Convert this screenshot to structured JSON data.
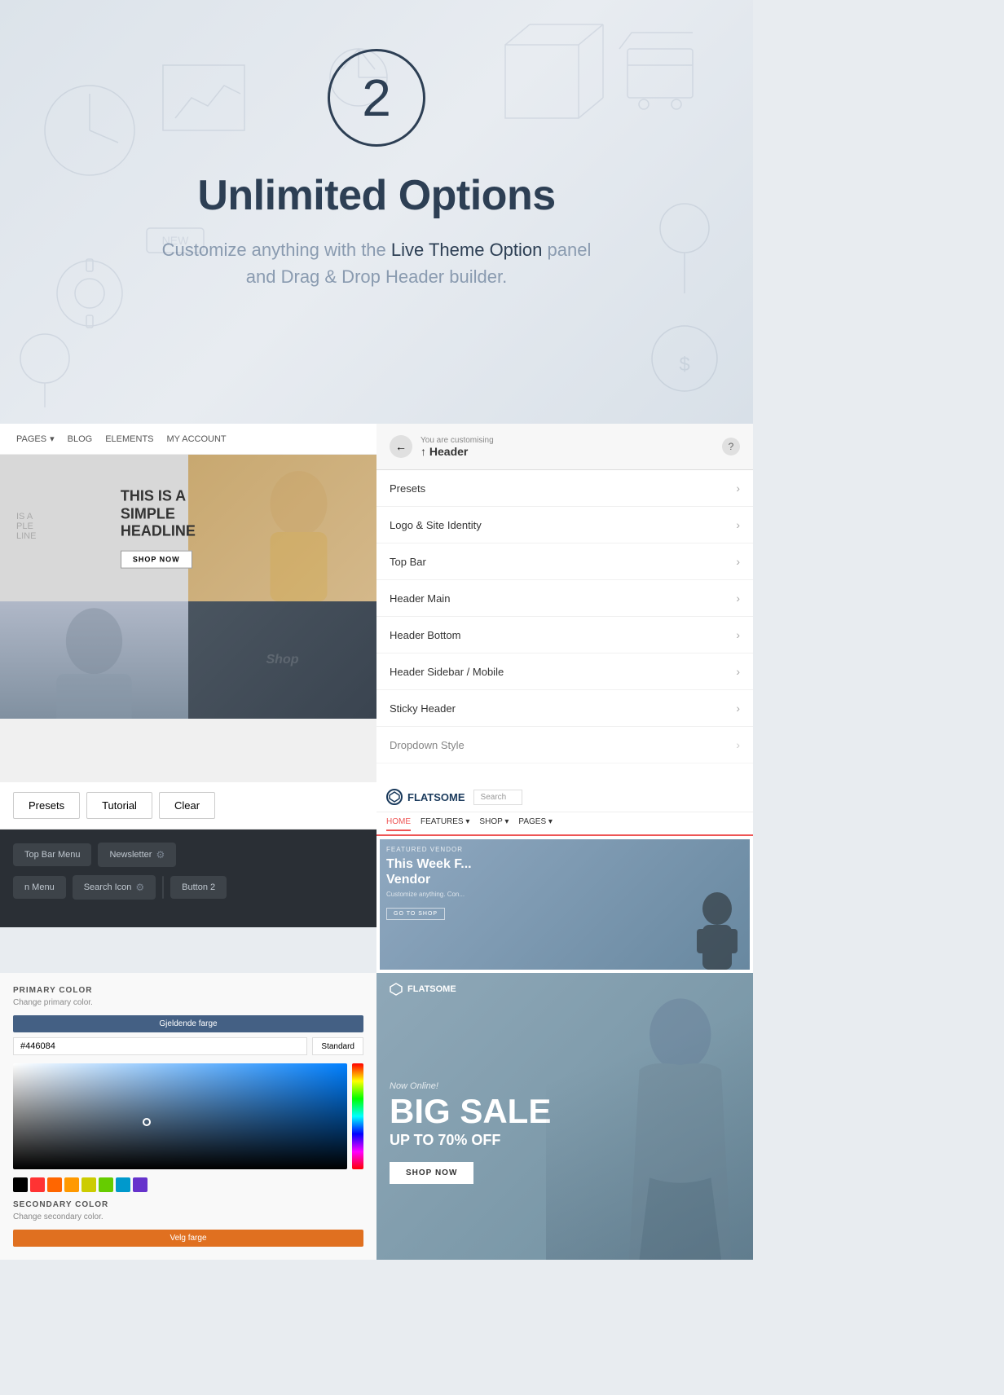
{
  "hero": {
    "step_number": "2",
    "title": "Unlimited Options",
    "subtitle_part1": "Customize anything with the ",
    "subtitle_highlight": "Live Theme Option",
    "subtitle_part2": " panel",
    "subtitle_line2": "and Drag & Drop Header builder."
  },
  "customizer": {
    "back_label": "←",
    "customising_label": "You are customising",
    "header_label": "↑ Header",
    "help_label": "?",
    "menu_items": [
      {
        "label": "Presets"
      },
      {
        "label": "Logo & Site Identity"
      },
      {
        "label": "Top Bar"
      },
      {
        "label": "Header Main"
      },
      {
        "label": "Header Bottom"
      },
      {
        "label": "Header Sidebar / Mobile"
      },
      {
        "label": "Sticky Header"
      },
      {
        "label": "Dropdown Style"
      }
    ]
  },
  "mockup_nav": {
    "items": [
      "PAGES",
      "BLOG",
      "ELEMENTS",
      "MY ACCOUNT"
    ]
  },
  "mockup_hero": {
    "headline": "THIS IS A\nSIMPLE\nHEADLINE",
    "shop_now": "SHOP NOW"
  },
  "flatsome": {
    "logo_text": "FLATSOME",
    "search_placeholder": "Search",
    "nav_links": [
      "HOME",
      "FEATURES",
      "SHOP",
      "PAGES"
    ],
    "vendor_label": "FEATURED VENDOR",
    "product_title": "This Week F...\nVendor",
    "product_sub": "Customize anything. Con...",
    "go_to_shop_btn": "GO TO SHOP"
  },
  "buttons": {
    "presets": "Presets",
    "tutorial": "Tutorial",
    "clear": "Clear"
  },
  "header_builder": {
    "row1_blocks": [
      "Top Bar Menu",
      "Newsletter"
    ],
    "row2_blocks": [
      "n Menu",
      "Search Icon",
      "Button 2"
    ]
  },
  "color_picker": {
    "primary_label": "PRIMARY COLOR",
    "primary_description": "Change primary color.",
    "preview_label": "Gjeldende farge",
    "hex_value": "#446084",
    "type_label": "Standard",
    "secondary_label": "SECONDARY COLOR",
    "secondary_description": "Change secondary color.",
    "secondary_btn_label": "Velg farge",
    "swatches": [
      "#000000",
      "#ff3333",
      "#ff6600",
      "#ff9900",
      "#cccc00",
      "#66cc00",
      "#0099cc",
      "#6633cc"
    ]
  },
  "big_sale": {
    "logo_text": "FLATSOME",
    "new_online_text": "Now Online!",
    "big_sale_text": "BIG SALE",
    "discount_text": "UP TO 70% OFF",
    "shop_now_btn": "SHOP NOW"
  }
}
